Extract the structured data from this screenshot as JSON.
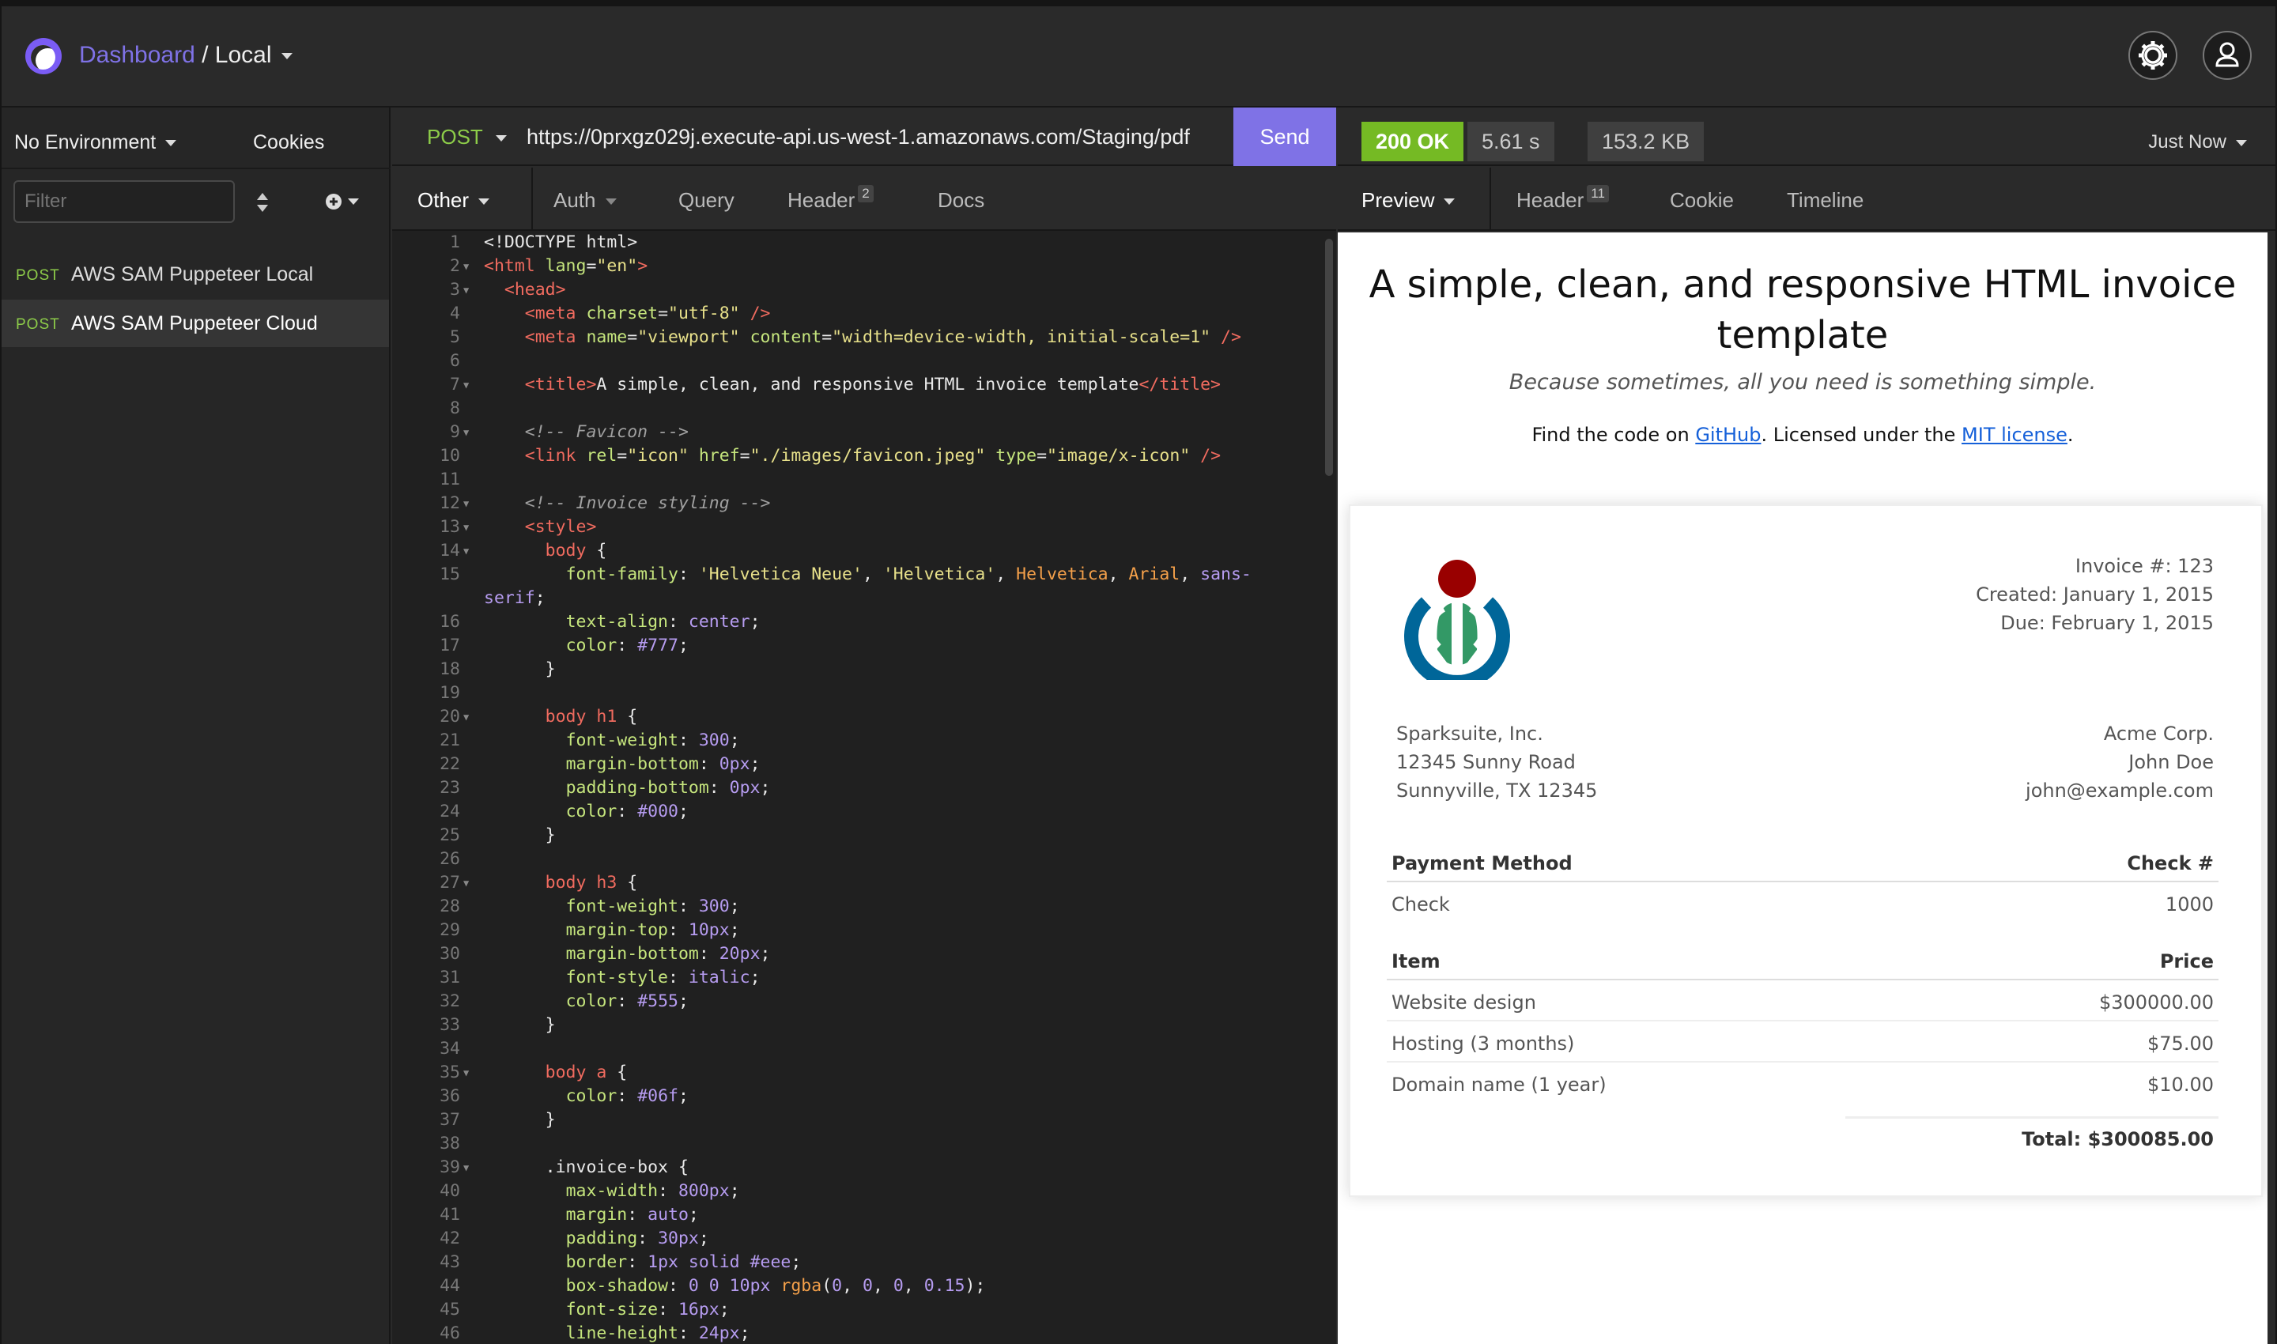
{
  "topbar": {
    "dashboard": "Dashboard",
    "separator": "/",
    "workspace": "Local"
  },
  "sidebar": {
    "environment": "No Environment",
    "cookies": "Cookies",
    "filter_placeholder": "Filter",
    "requests": [
      {
        "method": "POST",
        "name": "AWS SAM Puppeteer Local"
      },
      {
        "method": "POST",
        "name": "AWS SAM Puppeteer Cloud"
      }
    ]
  },
  "request": {
    "method": "POST",
    "url": "https://0prxgz029j.execute-api.us-west-1.amazonaws.com/Staging/pdf",
    "send": "Send",
    "tabs": [
      {
        "label": "Other"
      },
      {
        "label": "Auth"
      },
      {
        "label": "Query"
      },
      {
        "label": "Header",
        "badge": "2"
      },
      {
        "label": "Docs"
      }
    ]
  },
  "response": {
    "status": "200 OK",
    "time": "5.61 s",
    "size": "153.2 KB",
    "when": "Just Now",
    "tabs": [
      {
        "label": "Preview"
      },
      {
        "label": "Header",
        "badge": "11"
      },
      {
        "label": "Cookie"
      },
      {
        "label": "Timeline"
      }
    ]
  },
  "editor": {
    "lines": [
      {
        "n": "1",
        "f": false,
        "tokens": [
          [
            "",
            "<!DOCTYPE html>"
          ]
        ]
      },
      {
        "n": "2",
        "f": true,
        "tokens": [
          [
            "t-tag",
            "<html "
          ],
          [
            "t-attr",
            "lang"
          ],
          [
            "",
            "="
          ],
          [
            "t-str",
            "\"en\""
          ],
          [
            "t-tag",
            ">"
          ]
        ]
      },
      {
        "n": "3",
        "f": true,
        "tokens": [
          [
            "",
            "  "
          ],
          [
            "t-tag",
            "<head>"
          ]
        ]
      },
      {
        "n": "4",
        "f": false,
        "tokens": [
          [
            "",
            "    "
          ],
          [
            "t-tag",
            "<meta "
          ],
          [
            "t-attr",
            "charset"
          ],
          [
            "",
            "="
          ],
          [
            "t-str",
            "\"utf-8\""
          ],
          [
            "t-tag",
            " />"
          ]
        ]
      },
      {
        "n": "5",
        "f": false,
        "tokens": [
          [
            "",
            "    "
          ],
          [
            "t-tag",
            "<meta "
          ],
          [
            "t-attr",
            "name"
          ],
          [
            "",
            "="
          ],
          [
            "t-str",
            "\"viewport\""
          ],
          [
            "",
            " "
          ],
          [
            "t-attr",
            "content"
          ],
          [
            "",
            "="
          ],
          [
            "t-str",
            "\"width=device-width, initial-scale=1\""
          ],
          [
            "t-tag",
            " />"
          ]
        ]
      },
      {
        "n": "6",
        "f": false,
        "tokens": [
          [
            "",
            ""
          ]
        ]
      },
      {
        "n": "7",
        "f": true,
        "tokens": [
          [
            "",
            "    "
          ],
          [
            "t-tag",
            "<title>"
          ],
          [
            "",
            "A simple, clean, and responsive HTML invoice template"
          ],
          [
            "t-tag",
            "</title>"
          ]
        ]
      },
      {
        "n": "8",
        "f": false,
        "tokens": [
          [
            "",
            ""
          ]
        ]
      },
      {
        "n": "9",
        "f": true,
        "tokens": [
          [
            "",
            "    "
          ],
          [
            "t-cmt",
            "<!-- Favicon -->"
          ]
        ]
      },
      {
        "n": "10",
        "f": false,
        "tokens": [
          [
            "",
            "    "
          ],
          [
            "t-tag",
            "<link "
          ],
          [
            "t-attr",
            "rel"
          ],
          [
            "",
            "="
          ],
          [
            "t-str",
            "\"icon\""
          ],
          [
            "",
            " "
          ],
          [
            "t-attr",
            "href"
          ],
          [
            "",
            "="
          ],
          [
            "t-str",
            "\"./images/favicon.jpeg\""
          ],
          [
            "",
            " "
          ],
          [
            "t-attr",
            "type"
          ],
          [
            "",
            "="
          ],
          [
            "t-str",
            "\"image/x-icon\""
          ],
          [
            "t-tag",
            " />"
          ]
        ]
      },
      {
        "n": "11",
        "f": false,
        "tokens": [
          [
            "",
            ""
          ]
        ]
      },
      {
        "n": "12",
        "f": true,
        "tokens": [
          [
            "",
            "    "
          ],
          [
            "t-cmt",
            "<!-- Invoice styling -->"
          ]
        ]
      },
      {
        "n": "13",
        "f": true,
        "tokens": [
          [
            "",
            "    "
          ],
          [
            "t-tag",
            "<style>"
          ]
        ]
      },
      {
        "n": "14",
        "f": true,
        "tokens": [
          [
            "",
            "      "
          ],
          [
            "t-sel",
            "body"
          ],
          [
            "",
            " {"
          ]
        ]
      },
      {
        "n": "15",
        "f": false,
        "tokens": [
          [
            "",
            "        "
          ],
          [
            "t-prop",
            "font-family"
          ],
          [
            "",
            ": "
          ],
          [
            "t-str",
            "'Helvetica Neue'"
          ],
          [
            "",
            ", "
          ],
          [
            "t-str",
            "'Helvetica'"
          ],
          [
            "",
            ", "
          ],
          [
            "t-kw",
            "Helvetica"
          ],
          [
            "",
            ", "
          ],
          [
            "t-kw",
            "Arial"
          ],
          [
            "",
            ", "
          ],
          [
            "t-val",
            "sans-"
          ]
        ]
      },
      {
        "n": "",
        "f": false,
        "tokens": [
          [
            "t-val",
            "serif"
          ],
          [
            "",
            ";"
          ]
        ]
      },
      {
        "n": "16",
        "f": false,
        "tokens": [
          [
            "",
            "        "
          ],
          [
            "t-prop",
            "text-align"
          ],
          [
            "",
            ": "
          ],
          [
            "t-val",
            "center"
          ],
          [
            "",
            ";"
          ]
        ]
      },
      {
        "n": "17",
        "f": false,
        "tokens": [
          [
            "",
            "        "
          ],
          [
            "t-prop",
            "color"
          ],
          [
            "",
            ": "
          ],
          [
            "t-val",
            "#777"
          ],
          [
            "",
            ";"
          ]
        ]
      },
      {
        "n": "18",
        "f": false,
        "tokens": [
          [
            "",
            "      }"
          ]
        ]
      },
      {
        "n": "19",
        "f": false,
        "tokens": [
          [
            "",
            ""
          ]
        ]
      },
      {
        "n": "20",
        "f": true,
        "tokens": [
          [
            "",
            "      "
          ],
          [
            "t-sel",
            "body h1"
          ],
          [
            "",
            " {"
          ]
        ]
      },
      {
        "n": "21",
        "f": false,
        "tokens": [
          [
            "",
            "        "
          ],
          [
            "t-prop",
            "font-weight"
          ],
          [
            "",
            ": "
          ],
          [
            "t-val",
            "300"
          ],
          [
            "",
            ";"
          ]
        ]
      },
      {
        "n": "22",
        "f": false,
        "tokens": [
          [
            "",
            "        "
          ],
          [
            "t-prop",
            "margin-bottom"
          ],
          [
            "",
            ": "
          ],
          [
            "t-val",
            "0px"
          ],
          [
            "",
            ";"
          ]
        ]
      },
      {
        "n": "23",
        "f": false,
        "tokens": [
          [
            "",
            "        "
          ],
          [
            "t-prop",
            "padding-bottom"
          ],
          [
            "",
            ": "
          ],
          [
            "t-val",
            "0px"
          ],
          [
            "",
            ";"
          ]
        ]
      },
      {
        "n": "24",
        "f": false,
        "tokens": [
          [
            "",
            "        "
          ],
          [
            "t-prop",
            "color"
          ],
          [
            "",
            ": "
          ],
          [
            "t-val",
            "#000"
          ],
          [
            "",
            ";"
          ]
        ]
      },
      {
        "n": "25",
        "f": false,
        "tokens": [
          [
            "",
            "      }"
          ]
        ]
      },
      {
        "n": "26",
        "f": false,
        "tokens": [
          [
            "",
            ""
          ]
        ]
      },
      {
        "n": "27",
        "f": true,
        "tokens": [
          [
            "",
            "      "
          ],
          [
            "t-sel",
            "body h3"
          ],
          [
            "",
            " {"
          ]
        ]
      },
      {
        "n": "28",
        "f": false,
        "tokens": [
          [
            "",
            "        "
          ],
          [
            "t-prop",
            "font-weight"
          ],
          [
            "",
            ": "
          ],
          [
            "t-val",
            "300"
          ],
          [
            "",
            ";"
          ]
        ]
      },
      {
        "n": "29",
        "f": false,
        "tokens": [
          [
            "",
            "        "
          ],
          [
            "t-prop",
            "margin-top"
          ],
          [
            "",
            ": "
          ],
          [
            "t-val",
            "10px"
          ],
          [
            "",
            ";"
          ]
        ]
      },
      {
        "n": "30",
        "f": false,
        "tokens": [
          [
            "",
            "        "
          ],
          [
            "t-prop",
            "margin-bottom"
          ],
          [
            "",
            ": "
          ],
          [
            "t-val",
            "20px"
          ],
          [
            "",
            ";"
          ]
        ]
      },
      {
        "n": "31",
        "f": false,
        "tokens": [
          [
            "",
            "        "
          ],
          [
            "t-prop",
            "font-style"
          ],
          [
            "",
            ": "
          ],
          [
            "t-val",
            "italic"
          ],
          [
            "",
            ";"
          ]
        ]
      },
      {
        "n": "32",
        "f": false,
        "tokens": [
          [
            "",
            "        "
          ],
          [
            "t-prop",
            "color"
          ],
          [
            "",
            ": "
          ],
          [
            "t-val",
            "#555"
          ],
          [
            "",
            ";"
          ]
        ]
      },
      {
        "n": "33",
        "f": false,
        "tokens": [
          [
            "",
            "      }"
          ]
        ]
      },
      {
        "n": "34",
        "f": false,
        "tokens": [
          [
            "",
            ""
          ]
        ]
      },
      {
        "n": "35",
        "f": true,
        "tokens": [
          [
            "",
            "      "
          ],
          [
            "t-sel",
            "body a"
          ],
          [
            "",
            " {"
          ]
        ]
      },
      {
        "n": "36",
        "f": false,
        "tokens": [
          [
            "",
            "        "
          ],
          [
            "t-prop",
            "color"
          ],
          [
            "",
            ": "
          ],
          [
            "t-val",
            "#06f"
          ],
          [
            "",
            ";"
          ]
        ]
      },
      {
        "n": "37",
        "f": false,
        "tokens": [
          [
            "",
            "      }"
          ]
        ]
      },
      {
        "n": "38",
        "f": false,
        "tokens": [
          [
            "",
            ""
          ]
        ]
      },
      {
        "n": "39",
        "f": true,
        "tokens": [
          [
            "",
            "      .invoice-box {"
          ]
        ]
      },
      {
        "n": "40",
        "f": false,
        "tokens": [
          [
            "",
            "        "
          ],
          [
            "t-prop",
            "max-width"
          ],
          [
            "",
            ": "
          ],
          [
            "t-val",
            "800px"
          ],
          [
            "",
            ";"
          ]
        ]
      },
      {
        "n": "41",
        "f": false,
        "tokens": [
          [
            "",
            "        "
          ],
          [
            "t-prop",
            "margin"
          ],
          [
            "",
            ": "
          ],
          [
            "t-val",
            "auto"
          ],
          [
            "",
            ";"
          ]
        ]
      },
      {
        "n": "42",
        "f": false,
        "tokens": [
          [
            "",
            "        "
          ],
          [
            "t-prop",
            "padding"
          ],
          [
            "",
            ": "
          ],
          [
            "t-val",
            "30px"
          ],
          [
            "",
            ";"
          ]
        ]
      },
      {
        "n": "43",
        "f": false,
        "tokens": [
          [
            "",
            "        "
          ],
          [
            "t-prop",
            "border"
          ],
          [
            "",
            ": "
          ],
          [
            "t-val",
            "1px solid #eee"
          ],
          [
            "",
            ";"
          ]
        ]
      },
      {
        "n": "44",
        "f": false,
        "tokens": [
          [
            "",
            "        "
          ],
          [
            "t-prop",
            "box-shadow"
          ],
          [
            "",
            ": "
          ],
          [
            "t-val",
            "0 0 10px"
          ],
          [
            "",
            " "
          ],
          [
            "t-kw",
            "rgba"
          ],
          [
            "",
            "("
          ],
          [
            "t-val",
            "0"
          ],
          [
            "",
            ", "
          ],
          [
            "t-val",
            "0"
          ],
          [
            "",
            ", "
          ],
          [
            "t-val",
            "0"
          ],
          [
            "",
            ", "
          ],
          [
            "t-val",
            "0.15"
          ],
          [
            "",
            ");"
          ]
        ]
      },
      {
        "n": "45",
        "f": false,
        "tokens": [
          [
            "",
            "        "
          ],
          [
            "t-prop",
            "font-size"
          ],
          [
            "",
            ": "
          ],
          [
            "t-val",
            "16px"
          ],
          [
            "",
            ";"
          ]
        ]
      },
      {
        "n": "46",
        "f": false,
        "tokens": [
          [
            "",
            "        "
          ],
          [
            "t-prop",
            "line-height"
          ],
          [
            "",
            ": "
          ],
          [
            "t-val",
            "24px"
          ],
          [
            "",
            ";"
          ]
        ]
      }
    ]
  },
  "preview": {
    "title_line1": "A simple, clean, and responsive HTML invoice",
    "title_line2": "template",
    "subtitle": "Because sometimes, all you need is something simple.",
    "find_prefix": "Find the code on ",
    "github": "GitHub",
    "find_mid": ". Licensed under the ",
    "license": "MIT license",
    "find_suffix": ".",
    "invoice": {
      "number": "Invoice #: 123",
      "created": "Created: January 1, 2015",
      "due": "Due: February 1, 2015",
      "from": [
        "Sparksuite, Inc.",
        "12345 Sunny Road",
        "Sunnyville, TX 12345"
      ],
      "to": [
        "Acme Corp.",
        "John Doe",
        "john@example.com"
      ],
      "payment_head": {
        "l": "Payment Method",
        "r": "Check #"
      },
      "payment_row": {
        "l": "Check",
        "r": "1000"
      },
      "item_head": {
        "l": "Item",
        "r": "Price"
      },
      "items": [
        {
          "l": "Website design",
          "r": "$300000.00"
        },
        {
          "l": "Hosting (3 months)",
          "r": "$75.00"
        },
        {
          "l": "Domain name (1 year)",
          "r": "$10.00"
        }
      ],
      "total": "Total: $300085.00"
    }
  }
}
